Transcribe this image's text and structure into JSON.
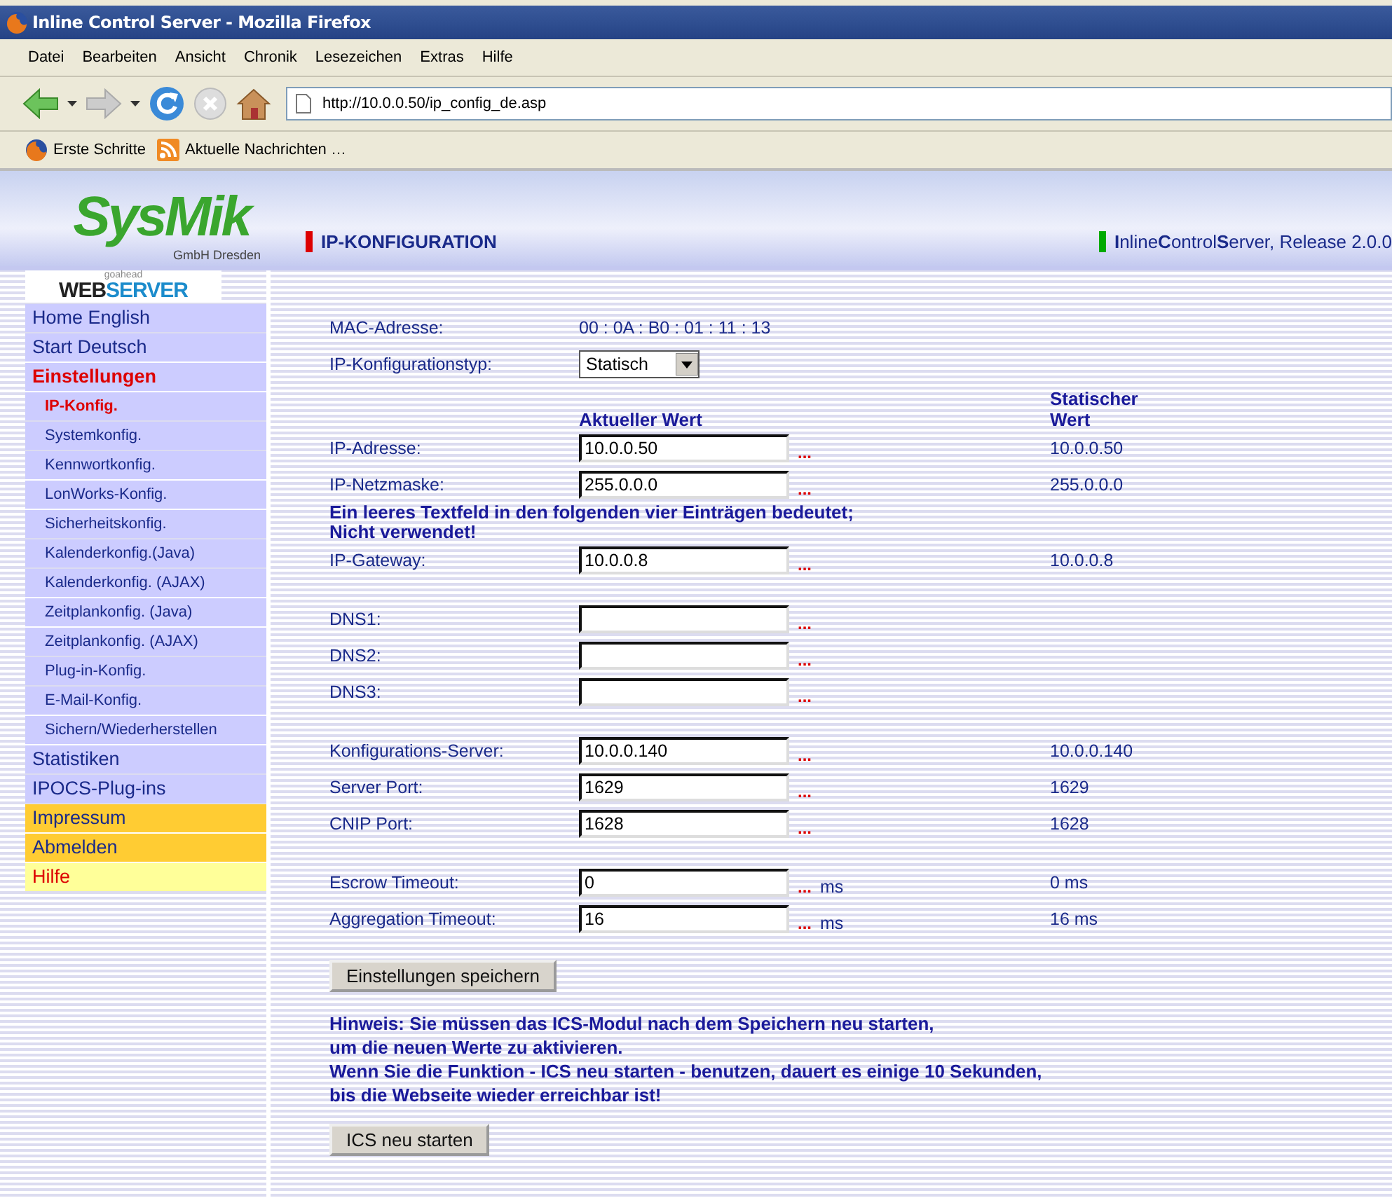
{
  "window": {
    "title": "Inline Control Server - Mozilla Firefox"
  },
  "menu": [
    "Datei",
    "Bearbeiten",
    "Ansicht",
    "Chronik",
    "Lesezeichen",
    "Extras",
    "Hilfe"
  ],
  "address_bar": {
    "value": "http://10.0.0.50/ip_config_de.asp"
  },
  "bookmarks": [
    {
      "label": "Erste Schritte",
      "kind": "browser"
    },
    {
      "label": "Aktuelle Nachrichten …",
      "kind": "feed"
    }
  ],
  "header": {
    "logo": "SysMik",
    "logo_subtitle": "GmbH Dresden",
    "page_title": "IP-KONFIGURATION",
    "release": "**I**nline**C**ontrol**S**erver, Release 2.0.0"
  },
  "sidebar": {
    "badge_small": "goahead",
    "badge_dark": "WEB",
    "badge_accent": "SERVER",
    "items": [
      {
        "label": "Home English",
        "kind": "main",
        "selected": false
      },
      {
        "label": "Start Deutsch",
        "kind": "main",
        "selected": false
      },
      {
        "label": "Einstellungen",
        "kind": "main",
        "selected": true
      },
      {
        "label": "IP-Konfig.",
        "kind": "sub",
        "selected": true
      },
      {
        "label": "Systemkonfig.",
        "kind": "sub",
        "selected": false
      },
      {
        "label": "Kennwortkonfig.",
        "kind": "sub",
        "selected": false
      },
      {
        "label": "LonWorks-Konfig.",
        "kind": "sub",
        "selected": false
      },
      {
        "label": "Sicherheitskonfig.",
        "kind": "sub",
        "selected": false
      },
      {
        "label": "Kalenderkonfig.(Java)",
        "kind": "sub",
        "selected": false
      },
      {
        "label": "Kalenderkonfig. (AJAX)",
        "kind": "sub",
        "selected": false
      },
      {
        "label": "Zeitplankonfig. (Java)",
        "kind": "sub",
        "selected": false
      },
      {
        "label": "Zeitplankonfig. (AJAX)",
        "kind": "sub",
        "selected": false
      },
      {
        "label": "Plug-in-Konfig.",
        "kind": "sub",
        "selected": false
      },
      {
        "label": "E-Mail-Konfig.",
        "kind": "sub",
        "selected": false
      },
      {
        "label": "Sichern/Wiederherstellen",
        "kind": "sub",
        "selected": false
      },
      {
        "label": "Statistiken",
        "kind": "main",
        "selected": false
      },
      {
        "label": "IPOCS-Plug-ins",
        "kind": "main",
        "selected": false
      },
      {
        "label": "Impressum",
        "kind": "orange",
        "selected": false
      },
      {
        "label": "Abmelden",
        "kind": "orange",
        "selected": false
      },
      {
        "label": "Hilfe",
        "kind": "yellow",
        "selected": false
      }
    ]
  },
  "form": {
    "sections": [
      [
        {
          "kind": "text",
          "label": "MAC-Adresse:",
          "value": "00 : 0A : B0 : 01 : 11 : 13"
        },
        {
          "kind": "select",
          "label": "IP-Konfigurationstyp:",
          "value": "Statisch"
        },
        {
          "kind": "header",
          "current": "Aktueller Wert",
          "static": "Statischer Wert"
        },
        {
          "kind": "field",
          "label": "IP-Adresse:",
          "value": "10.0.0.50",
          "marker": "...",
          "static": "10.0.0.50"
        },
        {
          "kind": "field",
          "label": "IP-Netzmaske:",
          "value": "255.0.0.0",
          "marker": "...",
          "static": "255.0.0.0"
        },
        {
          "kind": "notice",
          "text": "Ein leeres Textfeld in den folgenden vier Einträgen bedeutet; Nicht verwendet!"
        },
        {
          "kind": "field",
          "label": "IP-Gateway:",
          "value": "10.0.0.8",
          "marker": "...",
          "static": "10.0.0.8"
        }
      ],
      [
        {
          "kind": "field",
          "label": "DNS1:",
          "marker": "..."
        },
        {
          "kind": "field",
          "label": "DNS2:",
          "marker": "..."
        },
        {
          "kind": "field",
          "label": "DNS3:",
          "marker": "..."
        }
      ],
      [
        {
          "kind": "field",
          "label": "Konfigurations-Server:",
          "value": "10.0.0.140",
          "marker": "...",
          "static": "10.0.0.140"
        },
        {
          "kind": "field",
          "label": "Server Port:",
          "value": "1629",
          "marker": "...",
          "static": "1629"
        },
        {
          "kind": "field",
          "label": "CNIP Port:",
          "value": "1628",
          "marker": "...",
          "static": "1628"
        }
      ],
      [
        {
          "kind": "field",
          "label": "Escrow Timeout:",
          "value": "0",
          "marker": "...",
          "unit": "ms",
          "static": "0 ms"
        },
        {
          "kind": "field",
          "label": "Aggregation Timeout:",
          "value": "16",
          "marker": "...",
          "unit": "ms",
          "static": "16 ms"
        }
      ]
    ],
    "save_button": "Einstellungen speichern",
    "hint": [
      "Hinweis: Sie müssen das ICS-Modul nach dem Speichern neu starten,",
      "um die neuen Werte zu aktivieren.",
      "Wenn Sie die Funktion - ICS neu starten - benutzen, dauert es einige 10 Sekunden,",
      "bis die Webseite wieder erreichbar ist!"
    ],
    "restart_button": "ICS neu starten"
  }
}
